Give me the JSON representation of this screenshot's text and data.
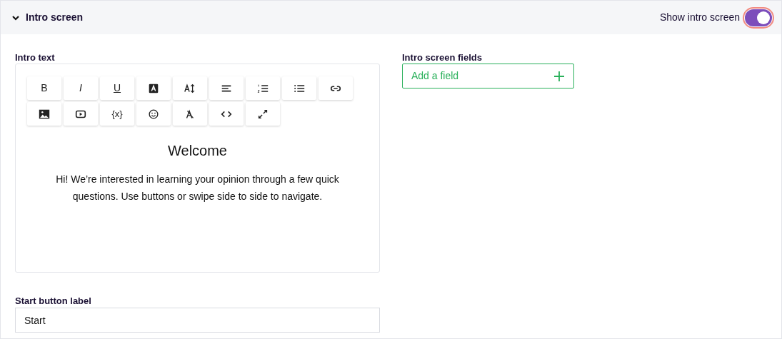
{
  "section": {
    "title": "Intro screen",
    "expanded": true,
    "toggle_label": "Show intro screen",
    "toggle_on": true
  },
  "intro_text": {
    "label": "Intro text",
    "toolbar": [
      {
        "kind": "text",
        "label": "B"
      },
      {
        "kind": "text",
        "label": "I"
      },
      {
        "kind": "text",
        "label": "U"
      },
      {
        "kind": "text-color"
      },
      {
        "kind": "font-size"
      },
      {
        "kind": "align"
      },
      {
        "kind": "ordered-list"
      },
      {
        "kind": "bullet-list"
      },
      {
        "kind": "link"
      },
      {
        "kind": "image"
      },
      {
        "kind": "video"
      },
      {
        "kind": "text",
        "label": "{x}"
      },
      {
        "kind": "emoji"
      },
      {
        "kind": "clear-format"
      },
      {
        "kind": "code"
      },
      {
        "kind": "fullscreen"
      }
    ],
    "heading": "Welcome",
    "body": "Hi! We’re interested in learning your opinion through a few quick questions. Use buttons or swipe side to side to navigate."
  },
  "start_button": {
    "label": "Start button label",
    "value": "Start"
  },
  "fields": {
    "label": "Intro screen fields",
    "add_button": "Add a field"
  }
}
